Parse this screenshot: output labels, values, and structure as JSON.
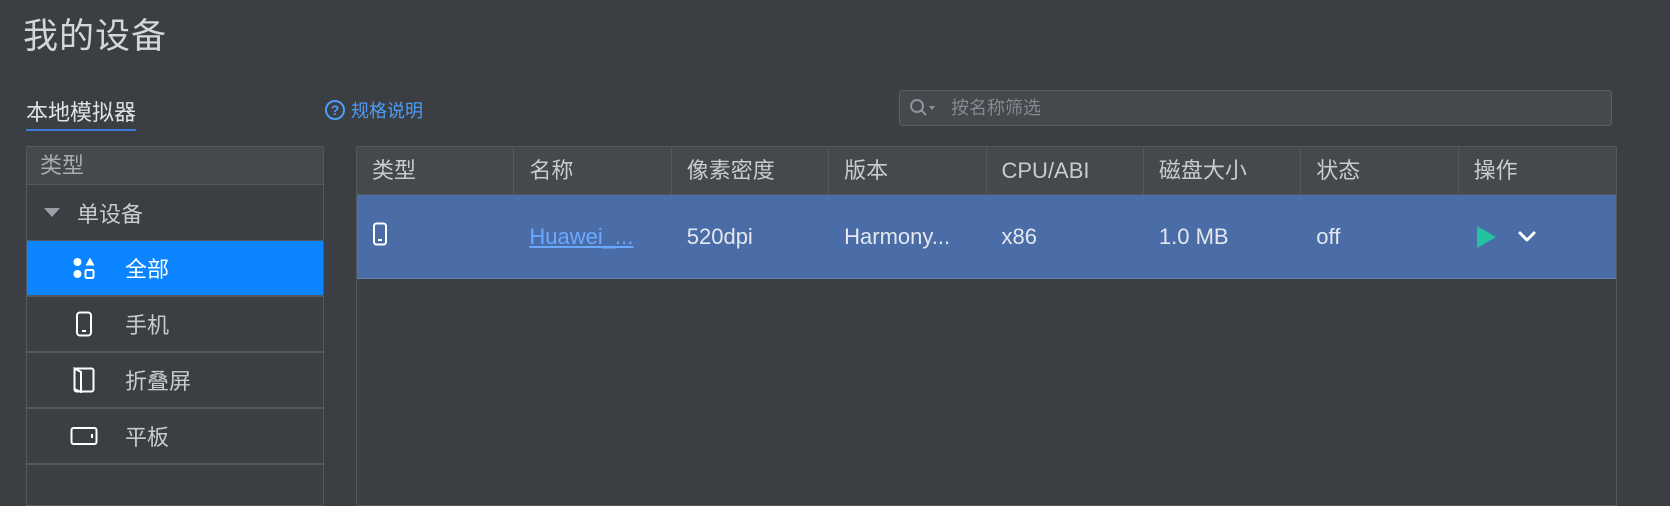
{
  "page": {
    "title": "我的设备"
  },
  "tabs": {
    "local": "本地模拟器"
  },
  "spec": {
    "label": "规格说明",
    "icon": "question-circle-icon"
  },
  "search": {
    "placeholder": "按名称筛选",
    "value": ""
  },
  "sidebar": {
    "header": "类型",
    "group": "单设备",
    "items": [
      {
        "label": "全部",
        "icon": "grid-shapes-icon",
        "active": true
      },
      {
        "label": "手机",
        "icon": "phone-icon",
        "active": false
      },
      {
        "label": "折叠屏",
        "icon": "foldable-icon",
        "active": false
      },
      {
        "label": "平板",
        "icon": "tablet-icon",
        "active": false
      }
    ]
  },
  "table": {
    "columns": [
      "类型",
      "名称",
      "像素密度",
      "版本",
      "CPU/ABI",
      "磁盘大小",
      "状态",
      "操作"
    ],
    "rows": [
      {
        "type_icon": "phone-icon",
        "name": "Huawei_...",
        "density": "520dpi",
        "version": "Harmony...",
        "cpu": "x86",
        "disk": "1.0 MB",
        "status": "off",
        "actions": [
          "play-icon",
          "chevron-down-icon"
        ]
      }
    ]
  },
  "colors": {
    "accent": "#0a84ff",
    "selected_row": "#4a6da7",
    "play": "#23c3a0",
    "link": "#4d9cf5"
  }
}
